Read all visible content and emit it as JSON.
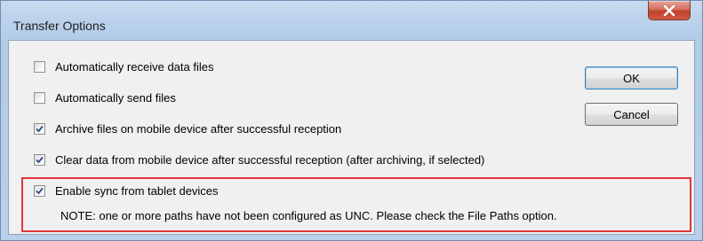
{
  "window": {
    "title": "Transfer Options",
    "close_icon": "close-icon"
  },
  "options": [
    {
      "label": "Automatically receive data files",
      "checked": false
    },
    {
      "label": "Automatically send files",
      "checked": false
    },
    {
      "label": "Archive files on mobile device after successful reception",
      "checked": true
    },
    {
      "label": "Clear data from mobile device after successful reception (after archiving, if selected)",
      "checked": true
    },
    {
      "label": "Enable sync from tablet devices",
      "checked": true
    }
  ],
  "note": "NOTE: one or more paths have not been configured as UNC.  Please check the File Paths option.",
  "buttons": {
    "ok_label": "OK",
    "cancel_label": "Cancel"
  },
  "colors": {
    "highlight": "#e0363a",
    "close_button": "#c0412b",
    "title_bar": "#bcd3ec"
  }
}
